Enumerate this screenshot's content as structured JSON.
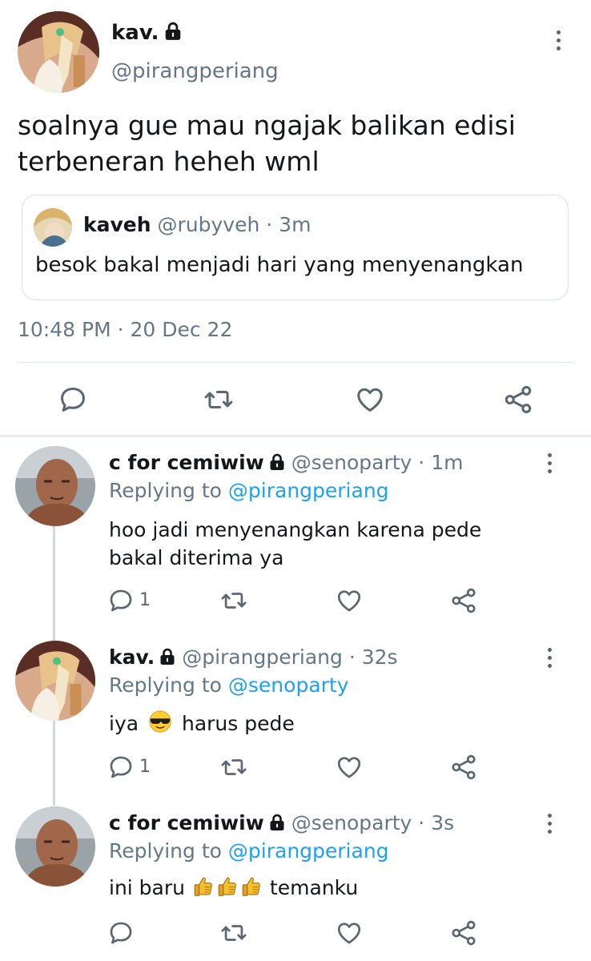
{
  "main_tweet": {
    "name": "kav.",
    "handle": "@pirangperiang",
    "text_line1": "soalnya gue mau ngajak balikan edisi",
    "text_line2": "terbeneran heheh wml",
    "quote": {
      "name": "kaveh",
      "handle": "@rubyveh",
      "separator": "·",
      "time": "3m",
      "text": "besok bakal menjadi hari yang menyenangkan"
    },
    "timestamp": "10:48 PM · 20 Dec 22"
  },
  "replies": [
    {
      "name": "c for cemiwiw",
      "handle": "@senoparty",
      "time": "· 1m",
      "replying_label": "Replying to",
      "replying_handle": "@pirangperiang",
      "text_line1": "hoo jadi menyenangkan karena pede",
      "text_line2": "bakal diterima ya",
      "reply_count": "1"
    },
    {
      "name": "kav.",
      "handle": "@pirangperiang",
      "time": "· 32s",
      "replying_label": "Replying to",
      "replying_handle": "@senoparty",
      "text_before": "iya",
      "text_after": "harus pede",
      "reply_count": "1"
    },
    {
      "name": "c for cemiwiw",
      "handle": "@senoparty",
      "time": "· 3s",
      "replying_label": "Replying to",
      "replying_handle": "@pirangperiang",
      "text_before": "ini baru",
      "text_after": "temanku",
      "reply_count": ""
    }
  ],
  "colors": {
    "link": "#1da1f2",
    "muted": "#657786",
    "icon": "#5b6670",
    "border": "#e1e8ed"
  },
  "icons": [
    "lock-icon",
    "more-icon",
    "reply-icon",
    "retweet-icon",
    "like-icon",
    "share-icon",
    "sunglasses-emoji",
    "thumbs-up-emoji"
  ]
}
